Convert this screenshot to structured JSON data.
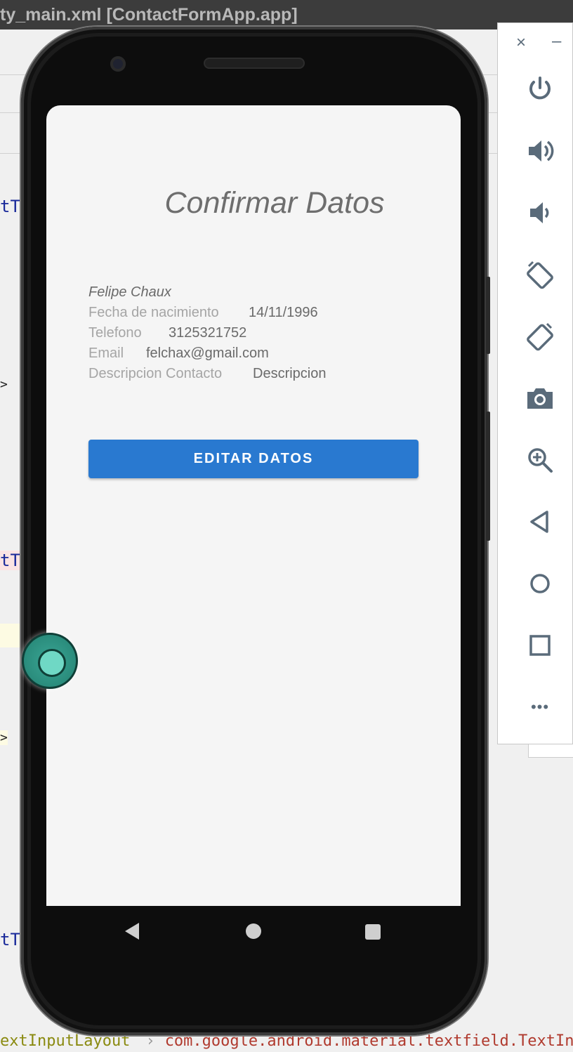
{
  "ide": {
    "title": "ty_main.xml [ContactFormApp.app]",
    "code_fragments": [
      "tTe",
      ">",
      "tTe",
      ">",
      "tTe"
    ],
    "breadcrumb": {
      "left": "extInputLayout",
      "separator": "›",
      "right": "com.google.android.material.textfield.TextInputE"
    }
  },
  "app": {
    "title": "Confirmar Datos",
    "name": "Felipe Chaux",
    "fields": [
      {
        "label": "Fecha de nacimiento",
        "value": "14/11/1996"
      },
      {
        "label": "Telefono",
        "value": "3125321752"
      },
      {
        "label": "Email",
        "value": "felchax@gmail.com"
      },
      {
        "label": "Descripcion Contacto",
        "value": "Descripcion"
      }
    ],
    "edit_button": "EDITAR DATOS"
  },
  "toolbar": {
    "close": "×",
    "minimize": "–",
    "buttons": [
      "power-icon",
      "volume-up-icon",
      "volume-down-icon",
      "rotate-left-icon",
      "rotate-right-icon",
      "camera-icon",
      "zoom-icon",
      "back-icon",
      "home-icon",
      "overview-icon",
      "more-icon"
    ],
    "more": "•••"
  },
  "colors": {
    "button": "#2979d0",
    "screen_bg": "#f5f5f5",
    "touch": "#3aa594"
  }
}
